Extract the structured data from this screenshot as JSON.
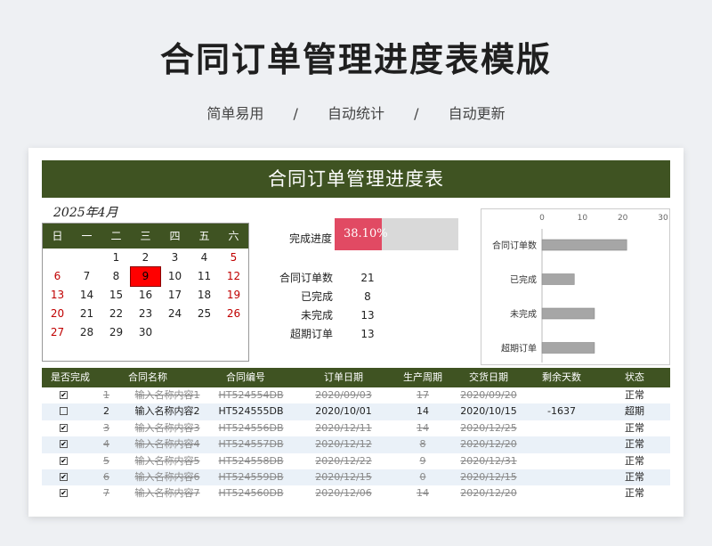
{
  "page": {
    "title": "合同订单管理进度表模版",
    "subtitle": [
      "简单易用",
      "/",
      "自动统计",
      "/",
      "自动更新"
    ]
  },
  "sheet": {
    "banner": "合同订单管理进度表",
    "month": "2025年4月"
  },
  "calendar": {
    "weekdays": [
      "日",
      "一",
      "二",
      "三",
      "四",
      "五",
      "六"
    ],
    "rows": [
      [
        "",
        "",
        "1",
        "2",
        "3",
        "4",
        "5"
      ],
      [
        "6",
        "7",
        "8",
        "9",
        "10",
        "11",
        "12"
      ],
      [
        "13",
        "14",
        "15",
        "16",
        "17",
        "18",
        "19"
      ],
      [
        "20",
        "21",
        "22",
        "23",
        "24",
        "25",
        "26"
      ],
      [
        "27",
        "28",
        "29",
        "30",
        "",
        "",
        ""
      ]
    ],
    "today": "9"
  },
  "progress": {
    "label": "完成进度",
    "text": "38.10%",
    "fraction": 0.381,
    "color": "#e14a63"
  },
  "stats": [
    {
      "label": "合同订单数",
      "value": "21"
    },
    {
      "label": "已完成",
      "value": "8"
    },
    {
      "label": "未完成",
      "value": "13"
    },
    {
      "label": "超期订单",
      "value": "13"
    }
  ],
  "chart_data": {
    "type": "bar",
    "orientation": "horizontal",
    "categories": [
      "合同订单数",
      "已完成",
      "未完成",
      "超期订单"
    ],
    "values": [
      21,
      8,
      13,
      13
    ],
    "xlim": [
      0,
      30
    ],
    "xticks": [
      "0",
      "10",
      "20",
      "30"
    ],
    "bar_color": "#a6a6a6",
    "grid": false
  },
  "table": {
    "headers": [
      "是否完成",
      "合同名称",
      "合同编号",
      "订单日期",
      "生产周期",
      "交货日期",
      "剩余天数",
      "状态"
    ],
    "rows": [
      {
        "done": true,
        "no": "1",
        "name": "输入名称内容1",
        "code": "HT524554DB",
        "order": "2020/09/03",
        "cycle": "17",
        "deliver": "2020/09/20",
        "left": "",
        "status": "正常"
      },
      {
        "done": false,
        "no": "2",
        "name": "输入名称内容2",
        "code": "HT524555DB",
        "order": "2020/10/01",
        "cycle": "14",
        "deliver": "2020/10/15",
        "left": "-1637",
        "status": "超期"
      },
      {
        "done": true,
        "no": "3",
        "name": "输入名称内容3",
        "code": "HT524556DB",
        "order": "2020/12/11",
        "cycle": "14",
        "deliver": "2020/12/25",
        "left": "",
        "status": "正常"
      },
      {
        "done": true,
        "no": "4",
        "name": "输入名称内容4",
        "code": "HT524557DB",
        "order": "2020/12/12",
        "cycle": "8",
        "deliver": "2020/12/20",
        "left": "",
        "status": "正常"
      },
      {
        "done": true,
        "no": "5",
        "name": "输入名称内容5",
        "code": "HT524558DB",
        "order": "2020/12/22",
        "cycle": "9",
        "deliver": "2020/12/31",
        "left": "",
        "status": "正常"
      },
      {
        "done": true,
        "no": "6",
        "name": "输入名称内容6",
        "code": "HT524559DB",
        "order": "2020/12/15",
        "cycle": "0",
        "deliver": "2020/12/15",
        "left": "",
        "status": "正常"
      },
      {
        "done": true,
        "no": "7",
        "name": "输入名称内容7",
        "code": "HT524560DB",
        "order": "2020/12/06",
        "cycle": "14",
        "deliver": "2020/12/20",
        "left": "",
        "status": "正常"
      }
    ]
  }
}
